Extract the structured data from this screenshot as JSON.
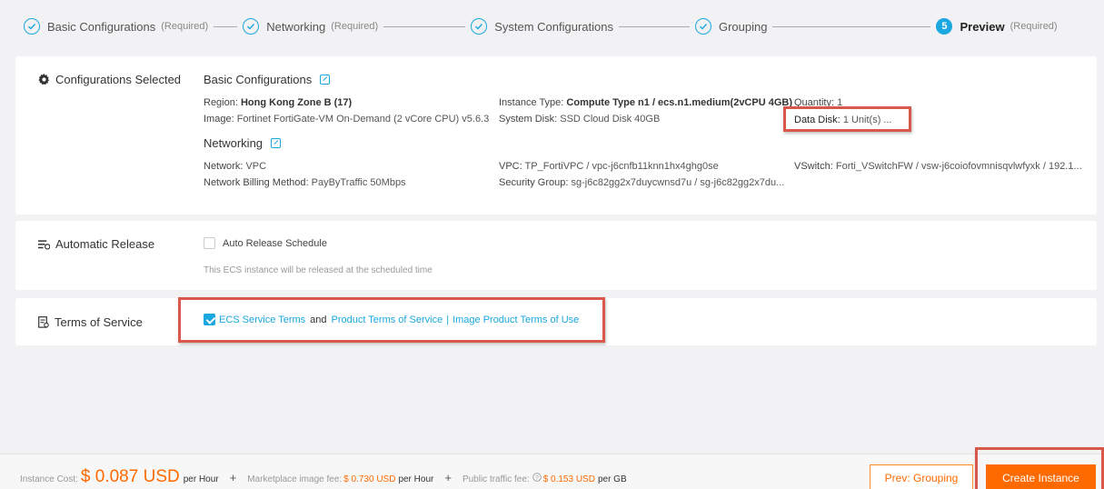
{
  "stepper": {
    "steps": [
      {
        "label": "Basic Configurations",
        "req": "(Required)"
      },
      {
        "label": "Networking",
        "req": "(Required)"
      },
      {
        "label": "System Configurations",
        "req": ""
      },
      {
        "label": "Grouping",
        "req": ""
      },
      {
        "num": "5",
        "label": "Preview",
        "req": "(Required)"
      }
    ]
  },
  "config": {
    "heading": "Configurations Selected",
    "basic": {
      "title": "Basic Configurations",
      "region_k": "Region:",
      "region_v": "Hong Kong Zone B (17)",
      "image_k": "Image:",
      "image_v": "Fortinet FortiGate-VM On-Demand (2 vCore CPU) v5.6.3",
      "itype_k": "Instance Type:",
      "itype_v": "Compute Type n1 / ecs.n1.medium(2vCPU 4GB)",
      "sdisk_k": "System Disk:",
      "sdisk_v": "SSD Cloud Disk 40GB",
      "qty_k": "Quantity:",
      "qty_v": "1",
      "ddisk_k": "Data Disk:",
      "ddisk_v": "1 Unit(s) ..."
    },
    "net": {
      "title": "Networking",
      "network_k": "Network:",
      "network_v": "VPC",
      "billing_k": "Network Billing Method:",
      "billing_v": "PayByTraffic 50Mbps",
      "vpc_k": "VPC:",
      "vpc_v": "TP_FortiVPC / vpc-j6cnfb11knn1hx4ghg0se",
      "sg_k": "Security Group:",
      "sg_v": "sg-j6c82gg2x7duycwnsd7u / sg-j6c82gg2x7du...",
      "vsw_k": "VSwitch:",
      "vsw_v": "Forti_VSwitchFW / vsw-j6coiofovmnisqvlwfyxk / 192.1..."
    }
  },
  "release": {
    "heading": "Automatic Release",
    "checkbox_label": "Auto Release Schedule",
    "note": "This ECS instance will be released at the scheduled time"
  },
  "terms": {
    "heading": "Terms of Service",
    "link1": "ECS Service Terms",
    "and": "and",
    "link2": "Product Terms of Service",
    "sep": "|",
    "link3": "Image Product Terms of Use"
  },
  "footer": {
    "cost_label": "Instance Cost:",
    "cost_value": "$ 0.087 USD",
    "cost_per": "per Hour",
    "plus": "+",
    "mkt_label": "Marketplace image fee:",
    "mkt_value": "$ 0.730 USD",
    "mkt_per": "per Hour",
    "traffic_label": "Public traffic fee:",
    "traffic_value": "$ 0.153 USD",
    "traffic_per": "per GB",
    "prev_button": "Prev: Grouping",
    "create_button": "Create Instance"
  },
  "colors": {
    "accent": "#1ba7df",
    "orange": "#ff6a00",
    "highlight": "#d8584a"
  }
}
